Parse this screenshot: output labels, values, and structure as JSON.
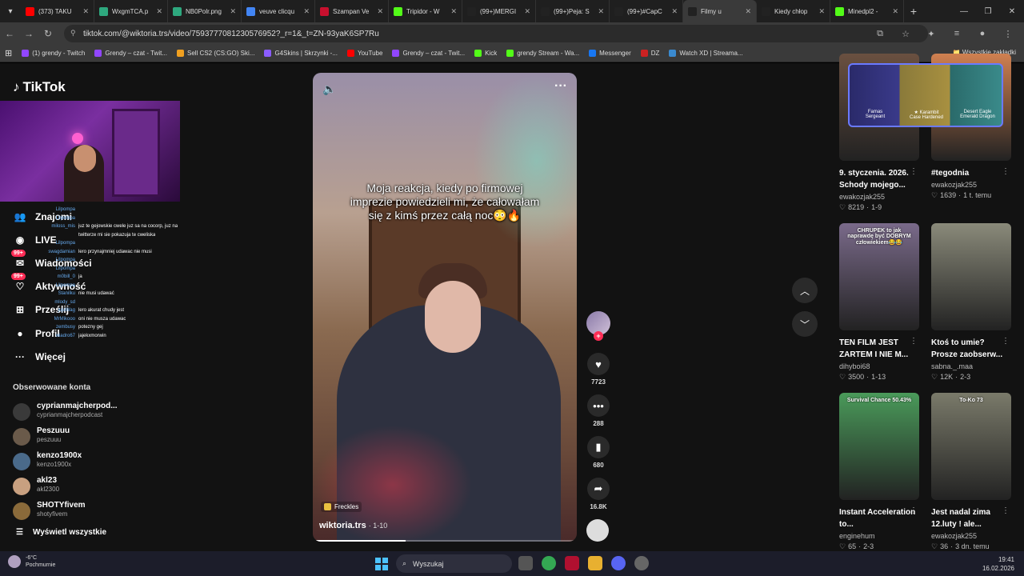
{
  "browser": {
    "tabs": [
      {
        "title": "(373) TAKU",
        "color": "#ff0000"
      },
      {
        "title": "WxgmTCA.p",
        "color": "#2ea87e"
      },
      {
        "title": "NB0Polr.png",
        "color": "#2ea87e"
      },
      {
        "title": "veuve clicqu",
        "color": "#4285f4"
      },
      {
        "title": "Szampan Ve",
        "color": "#c8102e"
      },
      {
        "title": "Tripidor - W",
        "color": "#53fc18"
      },
      {
        "title": "(99+)MERGI",
        "color": "#222222"
      },
      {
        "title": "(99+)Peja: S",
        "color": "#222222"
      },
      {
        "title": "(99+)#CapC",
        "color": "#222222"
      },
      {
        "title": "Filmy u",
        "color": "#222222",
        "active": true
      },
      {
        "title": "Kiedy chłop",
        "color": "#222222"
      },
      {
        "title": "Minedpl2 -",
        "color": "#53fc18"
      }
    ],
    "url": "tiktok.com/@wiktoria.trs/video/7593777081230576952?_r=1&_t=ZN-93yaK6SP7Ru",
    "bookmarks": [
      {
        "label": "(1) grendy - Twitch",
        "color": "#9146ff"
      },
      {
        "label": "Grendy – czat - Twit...",
        "color": "#9146ff"
      },
      {
        "label": "Sell CS2 (CS:GO) Ski...",
        "color": "#f0a020"
      },
      {
        "label": "G4Skins | Skrzynki -...",
        "color": "#8a5cff"
      },
      {
        "label": "YouTube",
        "color": "#ff0000"
      },
      {
        "label": "Grendy – czat - Twit...",
        "color": "#9146ff"
      },
      {
        "label": "Kick",
        "color": "#53fc18"
      },
      {
        "label": "grendy Stream - Wa...",
        "color": "#53fc18"
      },
      {
        "label": "Messenger",
        "color": "#1877f2"
      },
      {
        "label": "DZ",
        "color": "#cc2222"
      },
      {
        "label": "Watch XD | Streama...",
        "color": "#3a8ad0"
      }
    ],
    "bookmarks_right": "Wszystkie zakładki"
  },
  "tiktok": {
    "logo": "TikTok",
    "nav": [
      {
        "label": "Znajomi",
        "icon": "friends-icon"
      },
      {
        "label": "LIVE",
        "icon": "live-icon"
      },
      {
        "label": "Wiadomości",
        "icon": "messages-icon",
        "badge": "99+"
      },
      {
        "label": "Aktywność",
        "icon": "activity-icon",
        "badge": "99+"
      },
      {
        "label": "Prześlij",
        "icon": "upload-icon"
      },
      {
        "label": "Profil",
        "icon": "profile-icon"
      },
      {
        "label": "Więcej",
        "icon": "more-icon"
      }
    ],
    "followed_title": "Obserwowane konta",
    "followed": [
      {
        "name": "cyprianmajcherpod...",
        "user": "cyprianmajcherpodcast"
      },
      {
        "name": "Peszuuu",
        "user": "peszuuu"
      },
      {
        "name": "kenzo1900x",
        "user": "kenzo1900x"
      },
      {
        "name": "akl23",
        "user": "akl2300"
      },
      {
        "name": "SHOTYfivem",
        "user": "shotyfivem"
      }
    ],
    "show_all": "Wyświetl wszystkie",
    "video": {
      "caption": "Moja reakcja, kiedy po firmowej imprezie powiedzieli mi, że całowałam się z kimś przez całą noc😳🔥",
      "sound": "Freckles",
      "author": "wiktoria.trs",
      "date": "· 1-10",
      "progress": 0.35
    },
    "actions": {
      "likes": "7723",
      "comments": "288",
      "saves": "680",
      "shares": "16.8K"
    },
    "grid": [
      {
        "title": "9. styczenia. 2026. Schody mojego...",
        "author": "ewakozjak255",
        "likes": "8219",
        "date": "1-9",
        "thumb": "#6a5040"
      },
      {
        "title": "#tegodnia",
        "author": "ewakozjak255",
        "likes": "1639",
        "date": "1 t. temu",
        "thumb": "#d08050"
      },
      {
        "title": "TEN FILM JEST ZARTEM I NIE M...",
        "author": "dihyboi68",
        "likes": "3500",
        "date": "1-13",
        "thumb": "#7a6a8a",
        "overlay": "CHRUPEK to jak naprawdę być DOBRYM człowiekiem😂😂"
      },
      {
        "title": "Ktoś to umie? Prosze zaobserw...",
        "author": "sabna._.maa",
        "likes": "12K",
        "date": "2-3",
        "thumb": "#8a8a7a"
      },
      {
        "title": "Instant Acceleration to...",
        "author": "enginehum",
        "likes": "65",
        "date": "2-3",
        "thumb": "#4a9a5a",
        "overlay": "Survival Chance 50.43%"
      },
      {
        "title": "Jest nadal zima 12.luty ! ale...",
        "author": "ewakozjak255",
        "likes": "36",
        "date": "3 dn. temu",
        "thumb": "#7a7a6a",
        "overlay": "To-Ko 73"
      }
    ],
    "overlay_items": [
      {
        "name": "Famas",
        "sub": "Sergeant"
      },
      {
        "name": "★ Karambit",
        "sub": "Case Hardened"
      },
      {
        "name": "Desert Eagle",
        "sub": "Emerald Dragon"
      }
    ]
  },
  "stream_chat": [
    {
      "user": "Lilpompa",
      "msg": ""
    },
    {
      "user": "Lilpompa",
      "msg": ""
    },
    {
      "user": "miloss_mis",
      "msg": "juz te gejowskie cwele juz sa na cocorp, juz na"
    },
    {
      "user": "",
      "msg": "twitterze mi sie pokazuja te cweliska"
    },
    {
      "user": "Lilpompa",
      "msg": ""
    },
    {
      "user": "swagdamian",
      "msg": "lero przynajmniej udawac nie musi"
    },
    {
      "user": "Lilpompa",
      "msg": ""
    },
    {
      "user": "Lilpompa",
      "msg": ""
    },
    {
      "user": "m0bill_0",
      "msg": "ja"
    },
    {
      "user": "Lilpompa",
      "msg": ""
    },
    {
      "user": "Stanilku",
      "msg": "nie musi udawać"
    },
    {
      "user": "mlody_sd",
      "msg": ""
    },
    {
      "user": "jujuWag",
      "msg": "lero akurat chudy jest"
    },
    {
      "user": "MrMikooo",
      "msg": "oni nie musza udawac"
    },
    {
      "user": "zembusy",
      "msg": "potezny gej"
    },
    {
      "user": "wiadro67",
      "msg": "jajekxmorwin"
    }
  ],
  "taskbar": {
    "weather_temp": "-6°C",
    "weather_desc": "Pochmurnie",
    "search": "Wyszukaj",
    "time": "19:41",
    "date": "16.02.2026"
  }
}
